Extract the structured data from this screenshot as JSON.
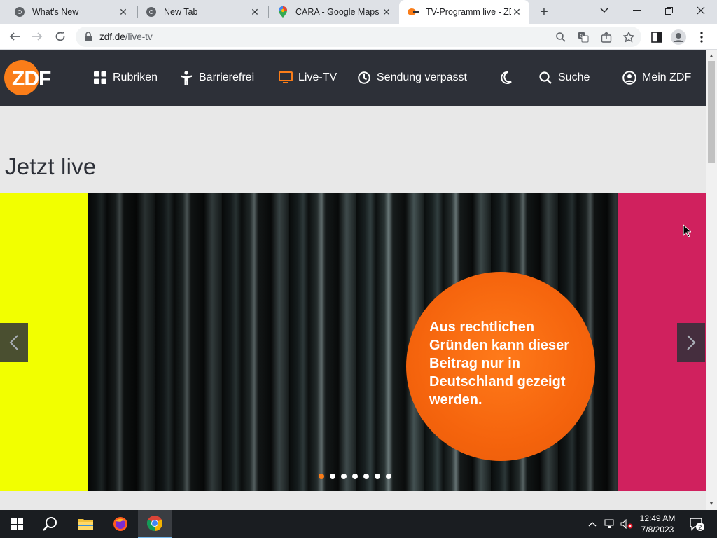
{
  "browser": {
    "tabs": [
      {
        "title": "What's New",
        "active": false
      },
      {
        "title": "New Tab",
        "active": false
      },
      {
        "title": "CARA - Google Maps",
        "active": false
      },
      {
        "title": "TV-Programm live - ZDF",
        "active": true
      }
    ],
    "url_host": "zdf.de",
    "url_path": "/live-tv"
  },
  "zdf": {
    "logo_text": "ZDF",
    "nav": [
      {
        "label": "Rubriken",
        "icon": "grid-icon"
      },
      {
        "label": "Barrierefrei",
        "icon": "accessibility-icon"
      },
      {
        "label": "Live-TV",
        "icon": "tv-icon"
      },
      {
        "label": "Sendung verpasst",
        "icon": "clock-icon"
      },
      {
        "label": "",
        "icon": "moon-icon"
      },
      {
        "label": "Suche",
        "icon": "search-icon"
      },
      {
        "label": "Mein ZDF",
        "icon": "user-icon"
      }
    ],
    "heading": "Jetzt live",
    "carousel": {
      "geo_message": "Aus rechtlichen Gründen kann dieser Beitrag nur in Deutschland gezeigt werden.",
      "slide_count": 7,
      "active_index": 0,
      "colors": {
        "left": "#f2ff00",
        "right": "#d0215e",
        "accent": "#fa7d19"
      }
    }
  },
  "taskbar": {
    "time": "12:49 AM",
    "date": "7/8/2023",
    "notifications": "2"
  }
}
